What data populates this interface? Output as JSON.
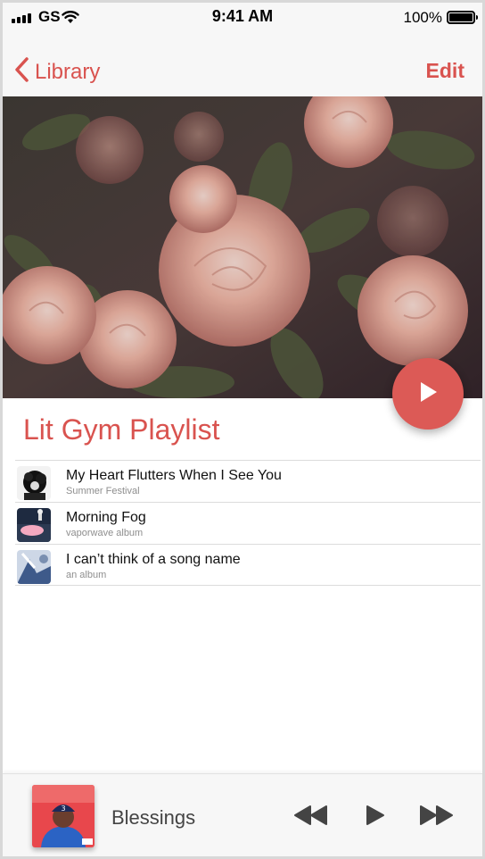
{
  "status_bar": {
    "carrier": "GS",
    "time": "9:41 AM",
    "battery": "100%"
  },
  "nav": {
    "back_label": "Library",
    "edit_label": "Edit"
  },
  "playlist": {
    "title": "Lit Gym Playlist",
    "tracks": [
      {
        "song": "My Heart Flutters When I See You",
        "album": "Summer Festival"
      },
      {
        "song": "Morning Fog",
        "album": "vaporwave album"
      },
      {
        "song": "I can’t think of a song name",
        "album": "an album"
      }
    ]
  },
  "player": {
    "now_playing": "Blessings"
  },
  "colors": {
    "accent": "#d9534f",
    "fab": "#dc5a56"
  },
  "icons": [
    "signal-icon",
    "wifi-icon",
    "battery-icon",
    "chevron-left-icon",
    "play-icon",
    "rewind-icon",
    "fast-forward-icon"
  ]
}
